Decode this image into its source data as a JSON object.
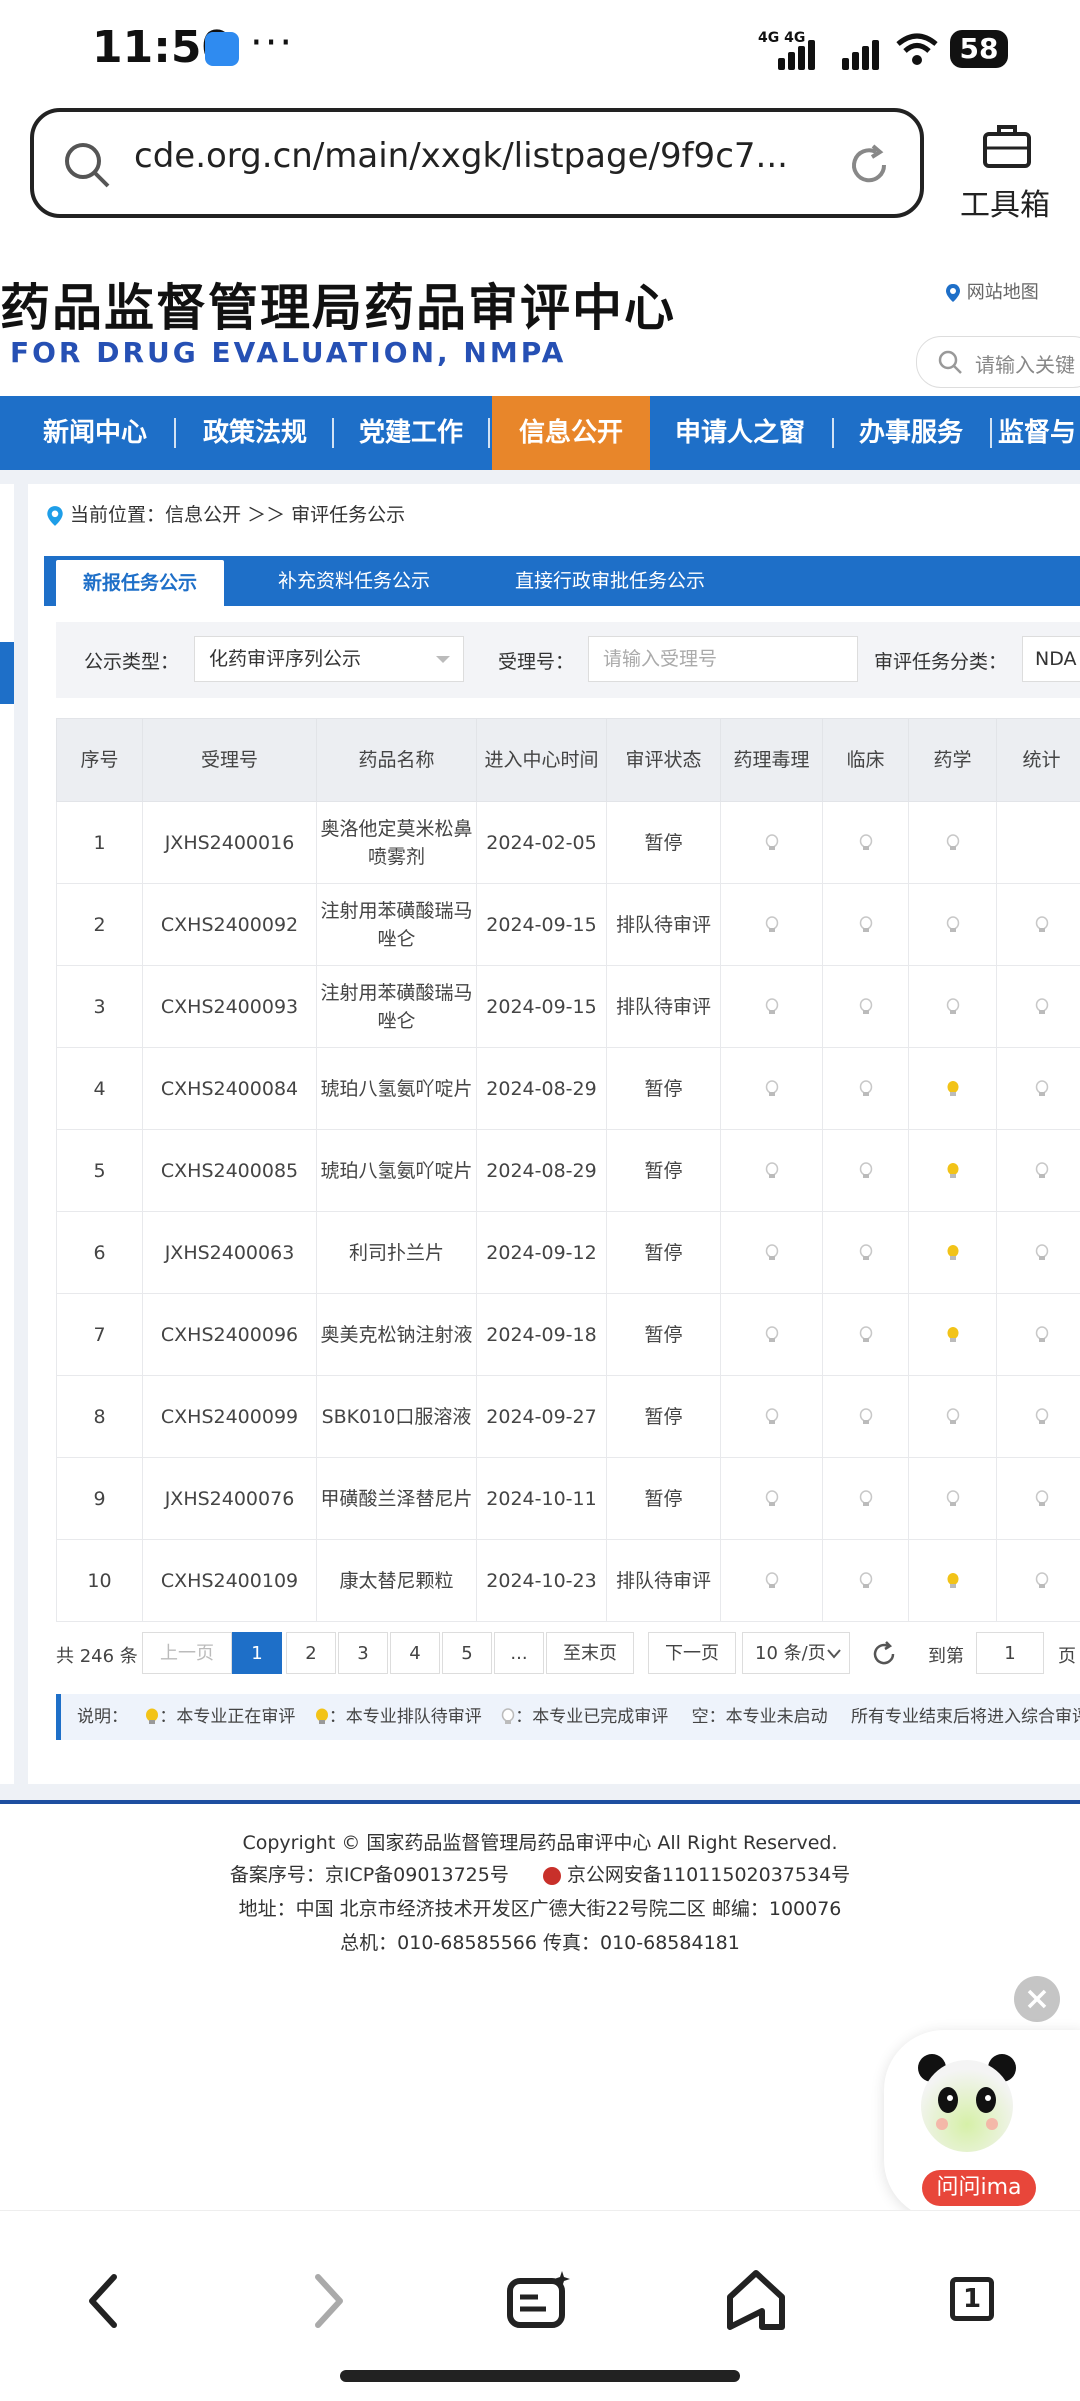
{
  "status_bar": {
    "time": "11:50",
    "more": "···",
    "network": "4G 4G",
    "battery": "58"
  },
  "browser": {
    "url": "cde.org.cn/main/xxgk/listpage/9f9c7...",
    "toolbox_label": "工具箱"
  },
  "site": {
    "title_cn": "药品监督管理局药品审评中心",
    "title_en": "FOR DRUG EVALUATION, NMPA",
    "sitemap": "网站地图",
    "search_placeholder": "请输入关键"
  },
  "nav": {
    "items": [
      "新闻中心",
      "政策法规",
      "党建工作",
      "信息公开",
      "申请人之窗",
      "办事服务",
      "监督与"
    ],
    "active_index": 3
  },
  "breadcrumb": {
    "prefix": "当前位置：",
    "path": "信息公开 ＞＞ 审评任务公示"
  },
  "tabs": [
    "新报任务公示",
    "补充资料任务公示",
    "直接行政审批任务公示"
  ],
  "filters": {
    "type_label": "公示类型：",
    "type_value": "化药审评序列公示",
    "acceptance_label": "受理号：",
    "acceptance_placeholder": "请输入受理号",
    "category_label": "审评任务分类：",
    "category_value": "NDA"
  },
  "table": {
    "headers": [
      "序号",
      "受理号",
      "药品名称",
      "进入中心时间",
      "审评状态",
      "药理毒理",
      "临床",
      "药学",
      "统计"
    ],
    "rows": [
      {
        "no": "1",
        "id": "JXHS2400016",
        "name": "奥洛他定莫米松鼻喷雾剂",
        "date": "2024-02-05",
        "status": "暂停",
        "bulbs": [
          "done",
          "done",
          "done",
          "none"
        ]
      },
      {
        "no": "2",
        "id": "CXHS2400092",
        "name": "注射用苯磺酸瑞马唑仑",
        "date": "2024-09-15",
        "status": "排队待审评",
        "bulbs": [
          "done",
          "done",
          "done",
          "done"
        ]
      },
      {
        "no": "3",
        "id": "CXHS2400093",
        "name": "注射用苯磺酸瑞马唑仑",
        "date": "2024-09-15",
        "status": "排队待审评",
        "bulbs": [
          "done",
          "done",
          "done",
          "done"
        ]
      },
      {
        "no": "4",
        "id": "CXHS2400084",
        "name": "琥珀八氢氨吖啶片",
        "date": "2024-08-29",
        "status": "暂停",
        "bulbs": [
          "done",
          "done",
          "active",
          "done"
        ]
      },
      {
        "no": "5",
        "id": "CXHS2400085",
        "name": "琥珀八氢氨吖啶片",
        "date": "2024-08-29",
        "status": "暂停",
        "bulbs": [
          "done",
          "done",
          "active",
          "done"
        ]
      },
      {
        "no": "6",
        "id": "JXHS2400063",
        "name": "利司扑兰片",
        "date": "2024-09-12",
        "status": "暂停",
        "bulbs": [
          "done",
          "done",
          "active",
          "done"
        ]
      },
      {
        "no": "7",
        "id": "CXHS2400096",
        "name": "奥美克松钠注射液",
        "date": "2024-09-18",
        "status": "暂停",
        "bulbs": [
          "done",
          "done",
          "active",
          "done"
        ]
      },
      {
        "no": "8",
        "id": "CXHS2400099",
        "name": "SBK010口服溶液",
        "date": "2024-09-27",
        "status": "暂停",
        "bulbs": [
          "done",
          "done",
          "done",
          "done"
        ]
      },
      {
        "no": "9",
        "id": "JXHS2400076",
        "name": "甲磺酸兰泽替尼片",
        "date": "2024-10-11",
        "status": "暂停",
        "bulbs": [
          "done",
          "done",
          "done",
          "done"
        ]
      },
      {
        "no": "10",
        "id": "CXHS2400109",
        "name": "康太替尼颗粒",
        "date": "2024-10-23",
        "status": "排队待审评",
        "bulbs": [
          "done",
          "done",
          "active",
          "done"
        ]
      }
    ]
  },
  "pagination": {
    "total": "共 246 条",
    "prev": "上一页",
    "pages": [
      "1",
      "2",
      "3",
      "4",
      "5"
    ],
    "ellipsis": "...",
    "last": "至末页",
    "next": "下一页",
    "page_size": "10 条/页",
    "goto_label": "到第",
    "goto_value": "1",
    "page_suffix": "页"
  },
  "legend": {
    "label": "说明：",
    "active": "：本专业正在审评",
    "queued": "：本专业排队待审评",
    "done": "：本专业已完成审评",
    "empty": "空：本专业未启动",
    "note": "所有专业结束后将进入综合审评阶"
  },
  "footer": {
    "copyright": "Copyright © 国家药品监督管理局药品审评中心    All Right Reserved.",
    "icp": "备案序号：京ICP备09013725号",
    "police": "京公网安备11011502037534号",
    "address": "地址：中国 北京市经济技术开发区广德大街22号院二区      邮编：100076",
    "phone": "总机：010-68585566      传真：010-68584181"
  },
  "assistant": {
    "label": "问问ima"
  },
  "bottom_nav": {
    "tabs_count": "1"
  },
  "colors": {
    "brand_blue": "#1e6fc8",
    "nav_active": "#e8862a",
    "bulb_active": "#f2c318",
    "bulb_done": "#c8c8c8"
  }
}
